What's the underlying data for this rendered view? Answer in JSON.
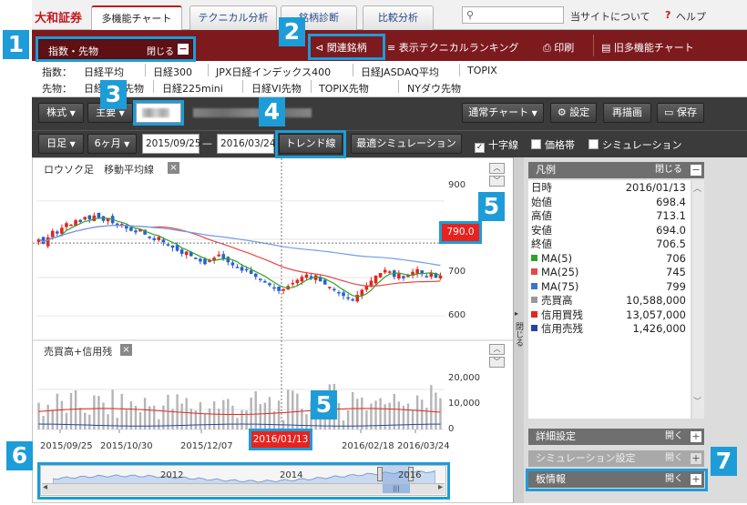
{
  "brand": {
    "logo": "大和証券"
  },
  "tabs": [
    {
      "label": "多機能チャート"
    },
    {
      "label": "テクニカル分析"
    },
    {
      "label": "銘柄診断"
    },
    {
      "label": "比較分析"
    }
  ],
  "search": {
    "icon": "search-icon"
  },
  "toplinks": {
    "about": "当サイトについて",
    "help_mark": "?",
    "help": "ヘルプ"
  },
  "redbar": {
    "index_label": "指数・先物",
    "close_label": "閉じる",
    "close_mark": "−",
    "related": "関連銘柄",
    "ranking": "表示テクニカルランキング",
    "print": "印刷",
    "old_chart": "旧多機能チャート"
  },
  "indices": {
    "row1_label": "指数：",
    "row1": [
      "日経平均",
      "日経300",
      "JPX日経インデックス400",
      "日経JASDAQ平均",
      "TOPIX"
    ],
    "row2_label": "先物：",
    "row2": [
      "日経平均先物",
      "日経225mini",
      "日経VI先物",
      "TOPIX先物",
      "NYダウ先物"
    ]
  },
  "toolbar1": {
    "market": "株式",
    "market_caret": "▼",
    "exchange": "主要",
    "exchange_caret": "▼",
    "chart_type": "通常チャート",
    "chart_type_caret": "▼",
    "settings": "設定",
    "redraw": "再描画",
    "save": "保存"
  },
  "toolbar2": {
    "interval": "日足",
    "interval_caret": "▼",
    "period": "6ヶ月",
    "period_caret": "▼",
    "date_from": "2015/09/25",
    "date_sep": "—",
    "date_to": "2016/03/24",
    "trendline": "トレンド線",
    "optimize": "最適シミュレーション",
    "check_crosshair": "十字線",
    "check_crosshair_mark": "✓",
    "check_band": "価格帯",
    "check_sim": "シミュレーション"
  },
  "chart": {
    "price_legend": "ロウソク足　移動平均線",
    "volume_legend": "売買高+信用残",
    "close_x": "×",
    "up_mark": "︿",
    "down_mark": "﹀",
    "price_ticks": [
      "900",
      "800",
      "700",
      "600"
    ],
    "volume_ticks": [
      "20,000",
      "10,000",
      "0"
    ],
    "cursor_price": "790.0",
    "cursor_date": "2016/01/13",
    "x_ticks": [
      "2015/09/25",
      "2015/10/30",
      "2015/12/07",
      "2016/02/18",
      "2016/03/24"
    ],
    "nav_years": [
      "2012",
      "2014",
      "2016"
    ],
    "nav_left": "◂",
    "nav_right": "▸",
    "nav_grip": "|||",
    "collapse_arrow": "▸",
    "collapse_label": "閉じる",
    "scroll_up": "︿",
    "scroll_down": "﹀",
    "colors": {
      "up": "#e8231e",
      "down": "#2a5fcf",
      "ma5": "#2aa52a",
      "ma25": "#e84646",
      "ma75": "#6f9ee8"
    }
  },
  "chart_data": {
    "type": "candlestick",
    "ylim": [
      560,
      940
    ],
    "yticks": [
      600,
      700,
      800,
      900
    ],
    "x_start": "2015/09/25",
    "x_end": "2016/03/24",
    "close": [
      800,
      788,
      805,
      822,
      815,
      830,
      842,
      838,
      850,
      845,
      858,
      852,
      862,
      856,
      848,
      855,
      842,
      835,
      840,
      828,
      822,
      818,
      826,
      812,
      805,
      798,
      806,
      792,
      785,
      778,
      770,
      762,
      768,
      756,
      748,
      742,
      735,
      746,
      752,
      760,
      748,
      740,
      732,
      725,
      718,
      722,
      710,
      702,
      696,
      688,
      680,
      672,
      665,
      670,
      678,
      686,
      694,
      702,
      708,
      698,
      706,
      690,
      682,
      676,
      668,
      660,
      652,
      645,
      640,
      655,
      668,
      680,
      692,
      705,
      712,
      720,
      716,
      702,
      710,
      698,
      706,
      715,
      722,
      710,
      704,
      712,
      700,
      705
    ],
    "ma5_note": "MA(5)",
    "volume_ylim": [
      0,
      30000
    ],
    "volume_yticks": [
      0,
      10000,
      20000
    ]
  },
  "legend_panel": {
    "title": "凡例",
    "close_label": "閉じる",
    "close_mark": "−",
    "rows": [
      {
        "label": "日時",
        "value": "2016/01/13",
        "color": ""
      },
      {
        "label": "始値",
        "value": "698.4",
        "color": ""
      },
      {
        "label": "高値",
        "value": "713.1",
        "color": ""
      },
      {
        "label": "安値",
        "value": "694.0",
        "color": ""
      },
      {
        "label": "終値",
        "value": "706.5",
        "color": ""
      },
      {
        "label": "MA(5)",
        "value": "706",
        "color": "#2aa52a"
      },
      {
        "label": "MA(25)",
        "value": "745",
        "color": "#e84646"
      },
      {
        "label": "MA(75)",
        "value": "799",
        "color": "#3d6fd8"
      },
      {
        "label": "売買高",
        "value": "10,588,000",
        "color": "#999999"
      },
      {
        "label": "信用買残",
        "value": "13,057,000",
        "color": "#e8231e"
      },
      {
        "label": "信用売残",
        "value": "1,426,000",
        "color": "#2244aa"
      }
    ],
    "detail": "詳細設定",
    "simulation": "シミュレーション設定",
    "board": "板情報",
    "open_label": "開く",
    "open_mark": "+"
  },
  "callouts": [
    "1",
    "2",
    "3",
    "4",
    "5",
    "6",
    "7"
  ]
}
